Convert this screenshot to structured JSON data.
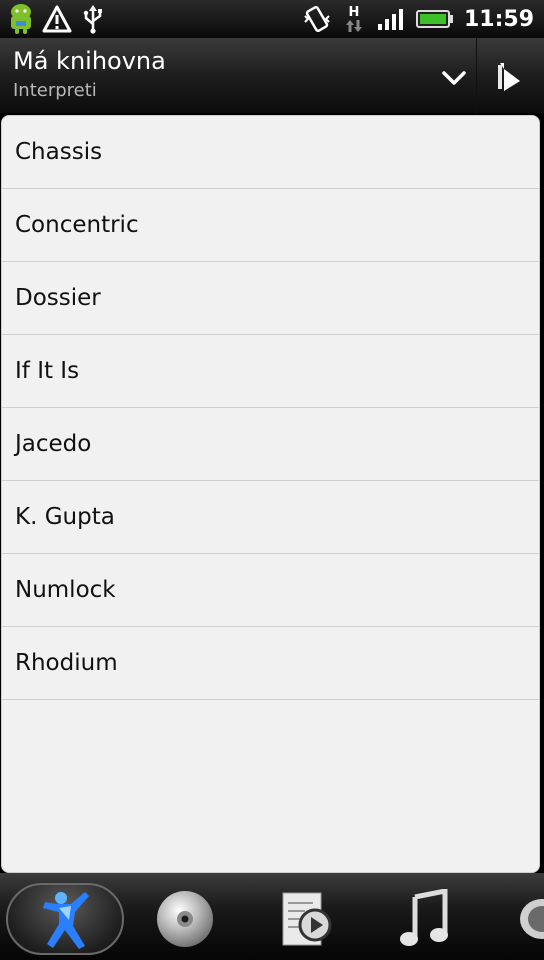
{
  "status_bar": {
    "time": "11:59",
    "network_label": "H"
  },
  "header": {
    "title": "Má knihovna",
    "subtitle": "Interpreti"
  },
  "artists": [
    "Chassis",
    "Concentric",
    "Dossier",
    "If It Is",
    "Jacedo",
    "K. Gupta",
    "Numlock",
    "Rhodium"
  ],
  "bottom_nav": {
    "items": [
      "artists-icon",
      "albums-icon",
      "playlists-icon",
      "songs-icon",
      "more-icon"
    ],
    "active": "artists-icon"
  },
  "colors": {
    "list_bg": "#f1f1f1",
    "divider": "#cfcfcf",
    "battery": "#3ec02a",
    "active_icon": "#2a7fff"
  }
}
